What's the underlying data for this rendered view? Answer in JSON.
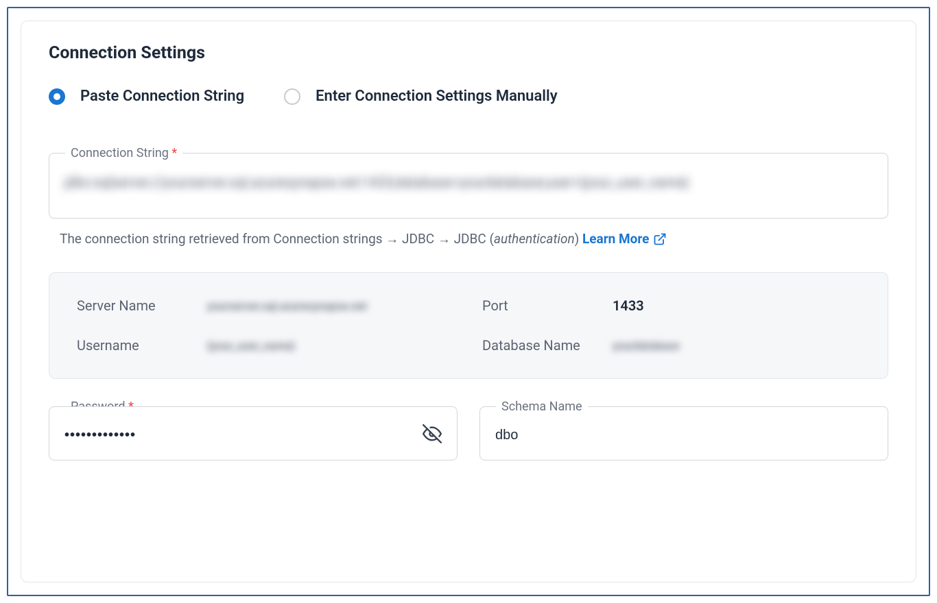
{
  "section": {
    "title": "Connection Settings"
  },
  "radio": {
    "paste_label": "Paste Connection String",
    "manual_label": "Enter Connection Settings Manually"
  },
  "connection_string": {
    "label": "Connection String",
    "required_mark": "*",
    "value": "jdbc:sqlserver://yourserver.sql.azuresynapse.net:1433;database=yourdatabase;user={your_user_name}",
    "helper_pre": "The connection string retrieved from Connection strings → JDBC → JDBC (",
    "helper_italic": "authentication",
    "helper_post": ") ",
    "learn_more": "Learn More"
  },
  "parsed": {
    "server_label": "Server Name",
    "server_value": "yourserver.sql.azuresynapse.net",
    "port_label": "Port",
    "port_value": "1433",
    "username_label": "Username",
    "username_value": "{your_user_name}",
    "database_label": "Database Name",
    "database_value": "yourdatabase"
  },
  "password": {
    "label": "Password",
    "required_mark": "*",
    "value": "•••••••••••••"
  },
  "schema": {
    "label": "Schema Name",
    "value": "dbo"
  }
}
